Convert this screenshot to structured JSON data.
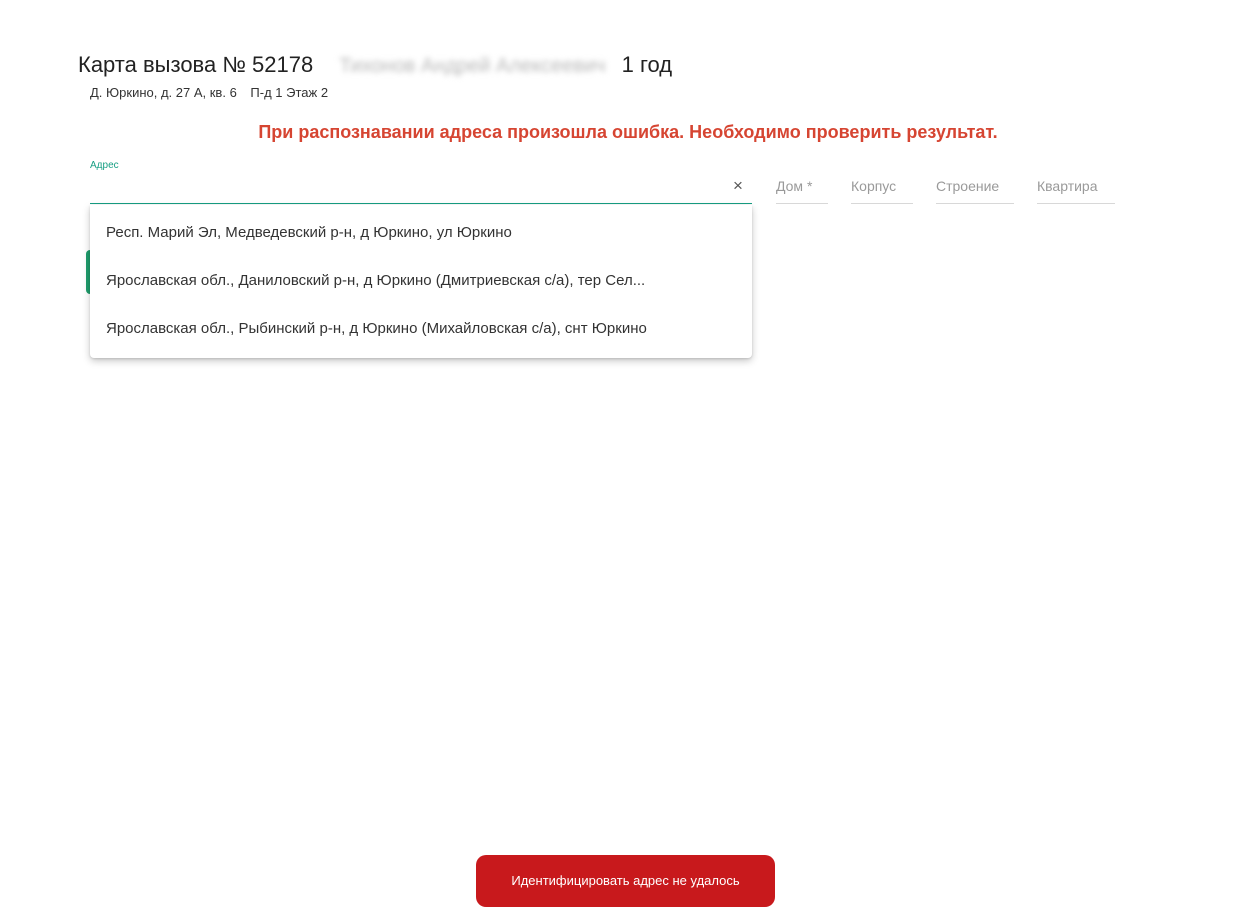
{
  "header": {
    "title": "Карта вызова № 52178",
    "patient_name": "Тихонов Андрей Алексеевич",
    "age": "1 год",
    "address_line": "Д. Юркино, д. 27 А, кв. 6",
    "entrance_floor": "П-д 1 Этаж 2"
  },
  "error_message": "При распознавании адреса произошла ошибка. Необходимо проверить результат.",
  "address_field": {
    "label": "Адрес",
    "value": "",
    "clear_icon": "×"
  },
  "fields": {
    "dom": "Дом *",
    "korpus": "Корпус",
    "stroenie": "Строение",
    "kvartira": "Квартира"
  },
  "suggestions": [
    "Респ. Марий Эл, Медведевский р-н, д Юркино, ул Юркино",
    "Ярославская обл., Даниловский р-н, д Юркино (Дмитриевская с/а), тер Сел...",
    "Ярославская обл., Рыбинский р-н, д Юркино (Михайловская с/а), снт Юркино"
  ],
  "toast": {
    "text": "Идентифицировать адрес не удалось"
  },
  "colors": {
    "accent": "#169e83",
    "error_text": "#d64532",
    "toast_bg": "#c8191c"
  }
}
